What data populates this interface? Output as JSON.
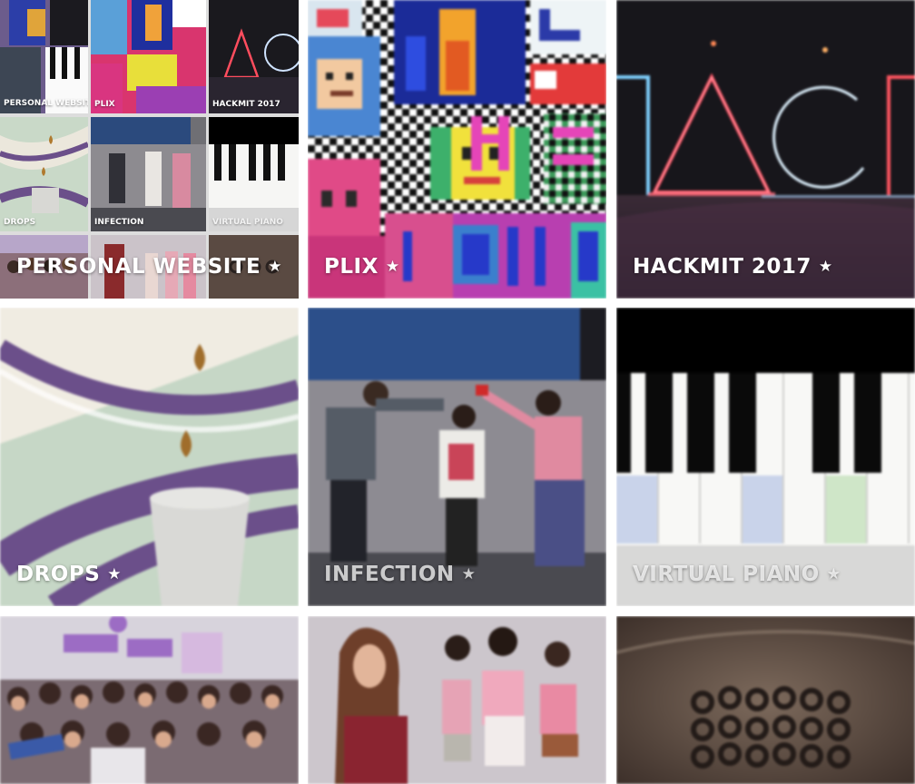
{
  "star_glyph": "★",
  "tiles": [
    {
      "title": "PERSONAL WEBSITE"
    },
    {
      "title": "PLIX"
    },
    {
      "title": "HACKMIT 2017"
    },
    {
      "title": "DROPS"
    },
    {
      "title": "INFECTION"
    },
    {
      "title": "VIRTUAL PIANO"
    },
    {
      "title": ""
    },
    {
      "title": ""
    },
    {
      "title": ""
    }
  ],
  "mini_tiles": [
    {
      "title": "PLIX"
    },
    {
      "title": "HACKMIT 2017"
    },
    {
      "title": "PERSONAL WEBSITE"
    },
    {
      "title": "PLIX"
    },
    {
      "title": "HACKMIT 2017"
    },
    {
      "title": "DROPS"
    },
    {
      "title": "INFECTION"
    },
    {
      "title": "VIRTUAL PIANO"
    }
  ],
  "colors": {
    "drops_purple": "#6b4f8a",
    "drops_mint": "#c9d9c8",
    "hackmit_bg": "#1b1a1f",
    "hackmit_neon_red": "#ff4d5e",
    "hackmit_neon_blue": "#7fd0ff",
    "piano_green": "#cfe6c8",
    "piano_blue": "#c9d3ea"
  }
}
